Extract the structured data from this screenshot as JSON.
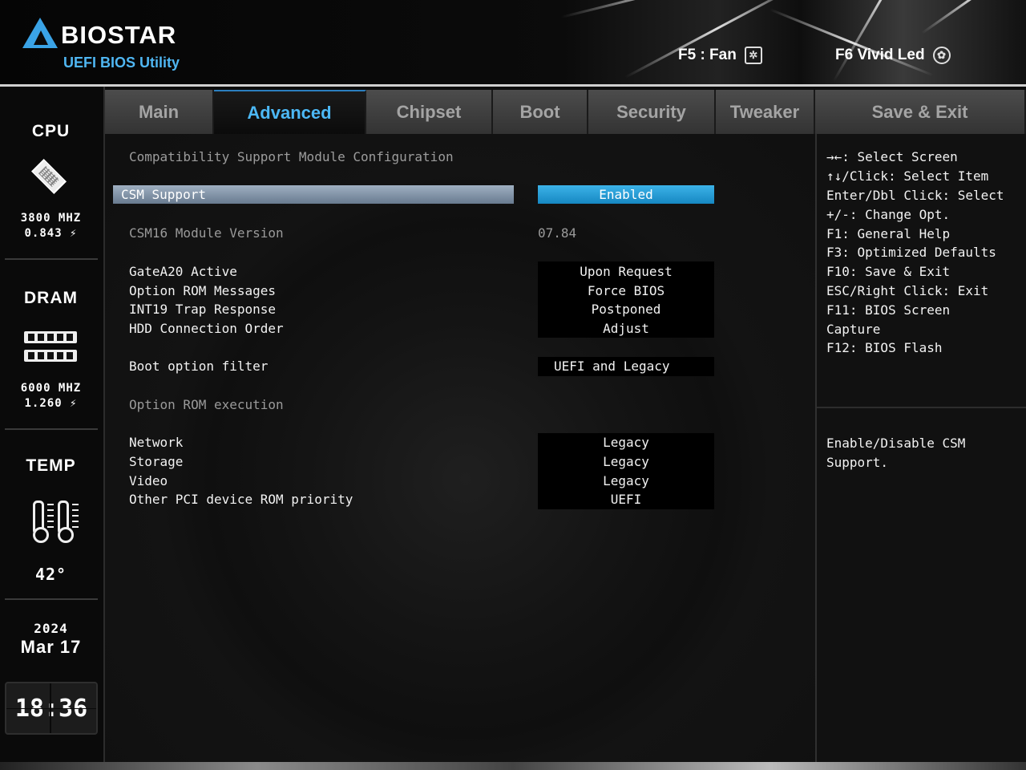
{
  "header": {
    "brand": "BIOSTAR",
    "subtitle": "UEFI BIOS Utility",
    "hotkeys": [
      {
        "label": "F5 : Fan",
        "icon": "fan-icon"
      },
      {
        "label": "F6 Vivid Led",
        "icon": "led-icon"
      }
    ]
  },
  "sidebar": {
    "cpu": {
      "label": "CPU",
      "freq": "3800 MHZ",
      "volt": "0.843 ⚡"
    },
    "dram": {
      "label": "DRAM",
      "freq": "6000 MHZ",
      "volt": "1.260 ⚡"
    },
    "temp": {
      "label": "TEMP",
      "value": "42°"
    },
    "date": {
      "year": "2024",
      "month_day": "Mar 17"
    },
    "time": "18:36"
  },
  "tabs": [
    "Main",
    "Advanced",
    "Chipset",
    "Boot",
    "Security",
    "Tweaker",
    "Save & Exit"
  ],
  "active_tab": "Advanced",
  "main": {
    "section_title": "Compatibility Support Module Configuration",
    "csm_support": {
      "label": "CSM Support",
      "value": "Enabled"
    },
    "csm16": {
      "label": "CSM16 Module Version",
      "value": "07.84"
    },
    "settings_group1": [
      {
        "label": "GateA20 Active",
        "value": "Upon Request"
      },
      {
        "label": "Option ROM Messages",
        "value": "Force BIOS"
      },
      {
        "label": "INT19 Trap Response",
        "value": "Postponed"
      },
      {
        "label": "HDD Connection Order",
        "value": "Adjust"
      }
    ],
    "boot_filter": {
      "label": "Boot option filter",
      "value": "UEFI and Legacy"
    },
    "rom_exec_title": "Option ROM execution",
    "settings_group2": [
      {
        "label": "Network",
        "value": "Legacy"
      },
      {
        "label": "Storage",
        "value": "Legacy"
      },
      {
        "label": "Video",
        "value": "Legacy"
      },
      {
        "label": "Other PCI device ROM priority",
        "value": "UEFI"
      }
    ]
  },
  "help": {
    "keys": [
      "→←: Select Screen",
      "↑↓/Click: Select Item",
      "Enter/Dbl Click: Select",
      "+/-: Change Opt.",
      "F1: General Help",
      "F3: Optimized Defaults",
      "F10: Save & Exit",
      "ESC/Right Click: Exit",
      "F11: BIOS Screen",
      "Capture",
      "F12: BIOS Flash"
    ],
    "description": [
      "Enable/Disable CSM",
      "Support."
    ]
  },
  "colors": {
    "accent": "#4cb8f5",
    "highlight": "#1f97d4"
  }
}
